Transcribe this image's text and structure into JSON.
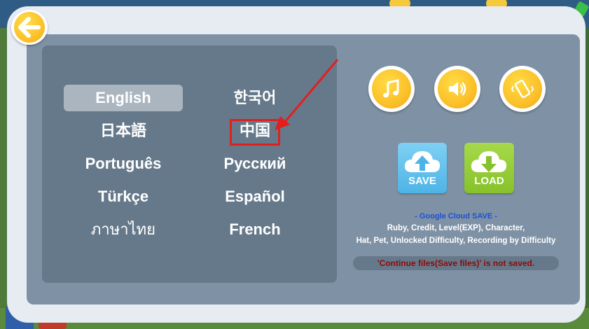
{
  "settings": {
    "languages": [
      {
        "label": "English",
        "selected": true
      },
      {
        "label": "한국어",
        "selected": false
      },
      {
        "label": "日本語",
        "selected": false
      },
      {
        "label": "中国",
        "selected": false
      },
      {
        "label": "Português",
        "selected": false
      },
      {
        "label": "Русский",
        "selected": false
      },
      {
        "label": "Türkçe",
        "selected": false
      },
      {
        "label": "Español",
        "selected": false
      },
      {
        "label": "ภาษาไทย",
        "selected": false
      },
      {
        "label": "French",
        "selected": false
      }
    ],
    "icons": {
      "back": "back-arrow-icon",
      "music": "music-note-icon",
      "sound": "speaker-icon",
      "vibration": "vibrate-icon",
      "save": "cloud-upload-icon",
      "load": "cloud-download-icon"
    },
    "save_label": "SAVE",
    "load_label": "LOAD",
    "cloud_title": "- Google Cloud SAVE -",
    "cloud_line1": "Ruby, Credit, Level(EXP), Character,",
    "cloud_line2": "Hat, Pet, Unlocked Difficulty, Recording by Difficulty",
    "warning": "'Continue files(Save files)' is not saved."
  },
  "colors": {
    "accent_yellow": "#fbc12a",
    "save_blue": "#4eb4e6",
    "load_green": "#86c22c",
    "highlight_red": "#e21f1f",
    "title_blue": "#1f4fd1",
    "warning_red": "#8a0a0a"
  }
}
